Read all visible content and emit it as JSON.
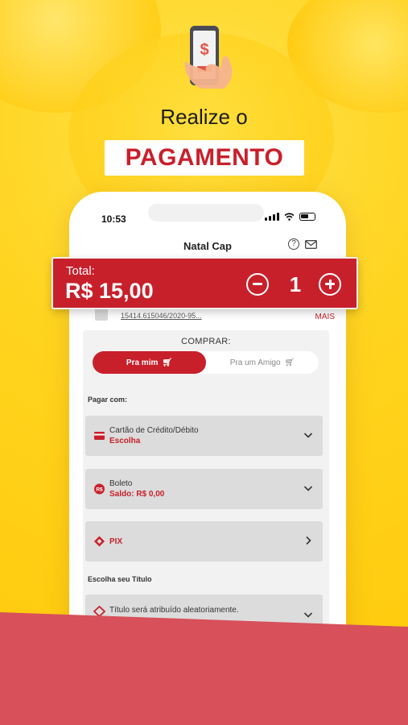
{
  "hero": {
    "title": "Realize o",
    "badge": "PAGAMENTO"
  },
  "status_bar": {
    "time": "10:53"
  },
  "app": {
    "title": "Natal Cap",
    "help_glyph": "?"
  },
  "ticket": {
    "code": "15414.615046/2020-95...",
    "more_label": "MAIS"
  },
  "purchase": {
    "label": "COMPRAR:",
    "options": [
      {
        "label": "Pra mim",
        "active": true
      },
      {
        "label": "Pra um Amigo",
        "active": false
      }
    ]
  },
  "payment": {
    "section_label": "Pagar com:",
    "methods": [
      {
        "title": "Cartão de Crédito/Débito",
        "subtitle": "Escolha",
        "icon": "credit-card-icon",
        "chevron": "down"
      },
      {
        "title": "Boleto",
        "subtitle": "Saldo: R$ 0,00",
        "icon": "money-icon",
        "chevron": "down"
      },
      {
        "title": "PIX",
        "subtitle": "",
        "icon": "pix-icon",
        "chevron": "right"
      }
    ]
  },
  "title_section": {
    "label": "Escolha seu Título",
    "option": "Título será atribuído aleatoriamente."
  },
  "total": {
    "label": "Total:",
    "value": "R$ 15,00",
    "quantity": "1"
  },
  "colors": {
    "brand_red": "#c8202b",
    "background_yellow": "#ffd21a",
    "bottom_band": "#d7505a"
  }
}
